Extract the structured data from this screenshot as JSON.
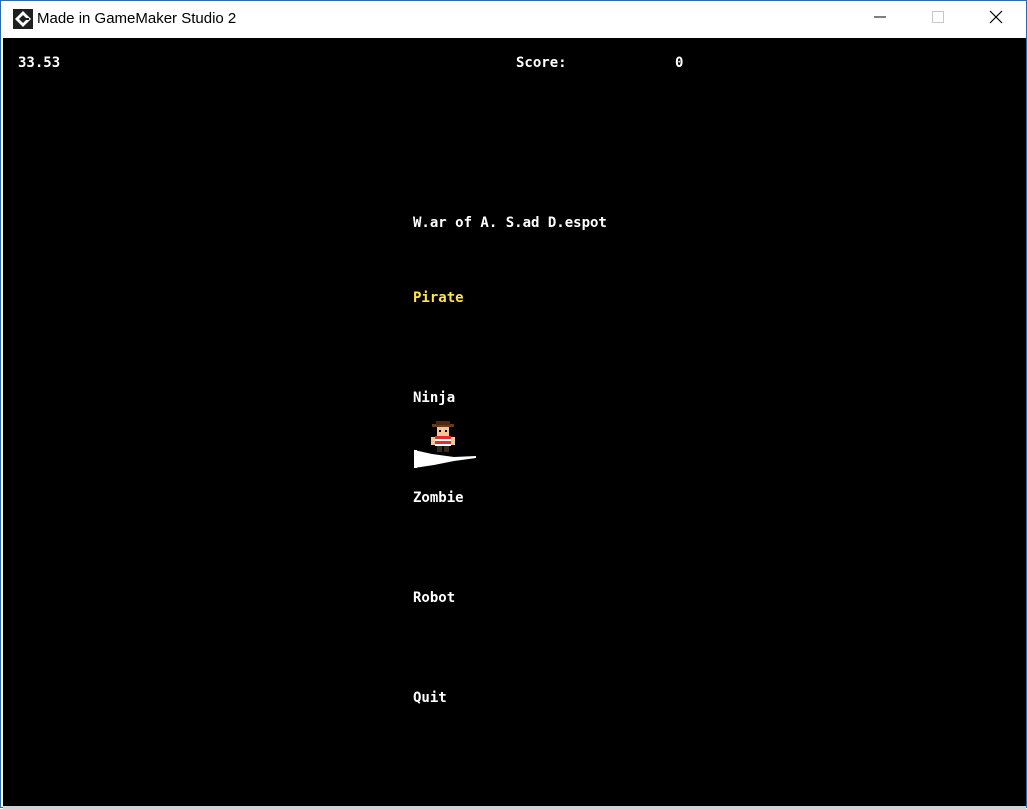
{
  "window": {
    "title": "Made in GameMaker Studio 2",
    "icons": {
      "app": "gamemaker-logo-icon",
      "minimize": "minimize-icon",
      "maximize": "maximize-icon",
      "close": "close-icon"
    }
  },
  "hud": {
    "fps": "33.53",
    "score_label": "Score:",
    "score_value": "0"
  },
  "menu": {
    "title": "W.ar of A. S.ad D.espot",
    "options": [
      "Pirate",
      "Ninja",
      "Zombie",
      "Robot",
      "Quit"
    ],
    "selected": "Pirate"
  },
  "sprite": {
    "name": "pirate-sprite"
  },
  "colors": {
    "background": "#000000",
    "text": "#ffffff",
    "highlight": "#ffe44a",
    "titlebar": "#ffffff"
  }
}
